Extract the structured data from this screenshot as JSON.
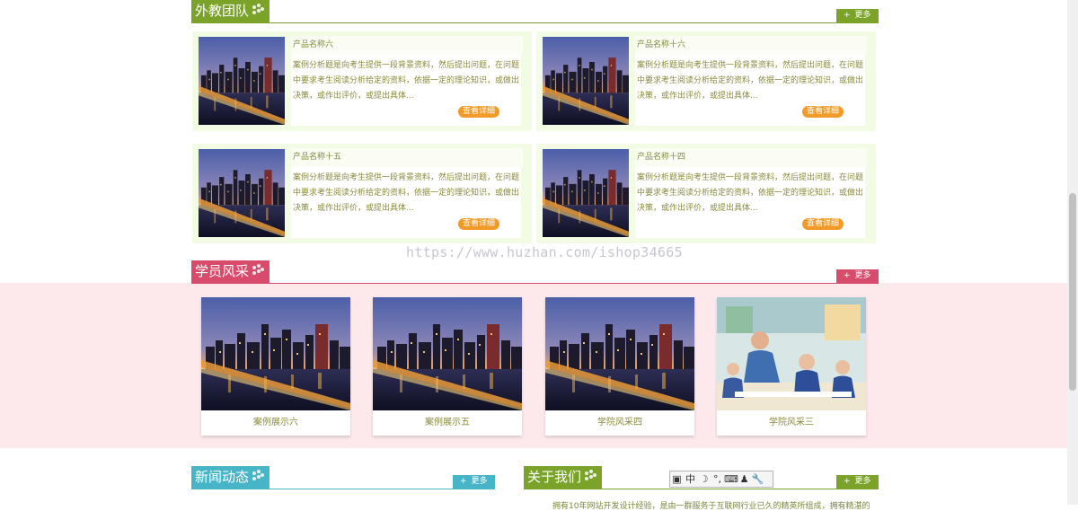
{
  "teachers": {
    "title": "外教团队",
    "more": "更多",
    "cards": [
      {
        "name": "产品名称六",
        "desc": "案例分析题是向考生提供一段背景资料，然后提出问题，在问题中要求考生阅读分析给定的资料，依据一定的理论知识，或做出决策，或作出评价，或提出具体...",
        "detail": "查看详细"
      },
      {
        "name": "产品名称十六",
        "desc": "案例分析题是向考生提供一段背景资料，然后提出问题，在问题中要求考生阅读分析给定的资料，依据一定的理论知识，或做出决策，或作出评价，或提出具体...",
        "detail": "查看详细"
      },
      {
        "name": "产品名称十五",
        "desc": "案例分析题是向考生提供一段背景资料，然后提出问题，在问题中要求考生阅读分析给定的资料，依据一定的理论知识，或做出决策，或作出评价，或提出具体...",
        "detail": "查看详细"
      },
      {
        "name": "产品名称十四",
        "desc": "案例分析题是向考生提供一段背景资料，然后提出问题，在问题中要求考生阅读分析给定的资料，依据一定的理论知识，或做出决策，或作出评价，或提出具体...",
        "detail": "查看详细"
      }
    ]
  },
  "watermark": "https://www.huzhan.com/ishop34665",
  "students": {
    "title": "学员风采",
    "more": "更多",
    "cards": [
      {
        "caption": "案例展示六",
        "image": "city-skyline"
      },
      {
        "caption": "案例展示五",
        "image": "city-skyline"
      },
      {
        "caption": "学院风采四",
        "image": "city-skyline"
      },
      {
        "caption": "学院风采三",
        "image": "classroom"
      }
    ]
  },
  "news": {
    "title": "新闻动态",
    "more": "更多"
  },
  "about": {
    "title": "关于我们",
    "more": "更多",
    "text": "拥有10年网站开发设计经验，是由一群服务于互联网行业已久的精英所组成，拥有精湛的"
  },
  "ime_toolbar": [
    "中",
    "☽",
    "°,",
    "⌨",
    "♟",
    "🔧"
  ],
  "colors": {
    "green": "#7ba32a",
    "pink": "#d84b6a",
    "teal": "#47b5c7",
    "card_bg": "#f2fbe3",
    "band_bg": "#fde9ec",
    "detail_btn": "#f29a27"
  }
}
